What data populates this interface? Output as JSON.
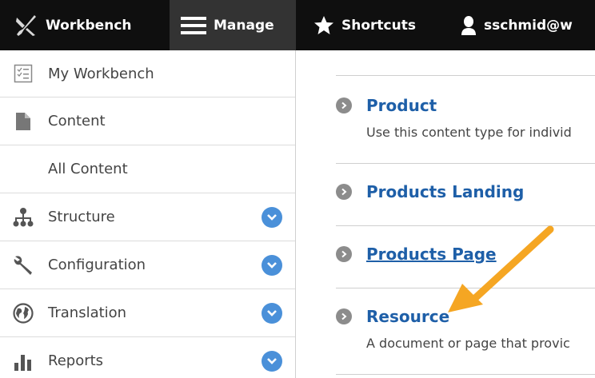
{
  "toolbar": {
    "workbench": "Workbench",
    "manage": "Manage",
    "shortcuts": "Shortcuts",
    "user": "sschmid@w"
  },
  "sidebar": {
    "items": [
      {
        "label": "My Workbench",
        "icon": "checklist-icon"
      },
      {
        "label": "Content",
        "icon": "document-icon"
      },
      {
        "label": "All Content"
      },
      {
        "label": "Structure",
        "icon": "sitemap-icon"
      },
      {
        "label": "Configuration",
        "icon": "wrench-icon"
      },
      {
        "label": "Translation",
        "icon": "globe-icon"
      },
      {
        "label": "Reports",
        "icon": "bar-chart-icon"
      }
    ]
  },
  "content_types": [
    {
      "name": "Product",
      "description": "Use this content type for individ"
    },
    {
      "name": "Products Landing",
      "description": ""
    },
    {
      "name": "Products Page",
      "description": ""
    },
    {
      "name": "Resource",
      "description": "A document or page that provic"
    }
  ],
  "colors": {
    "toolbar_bg": "#0f0f0f",
    "active_tab": "#333333",
    "link": "#1e5fa8",
    "toggle": "#4a90d9",
    "arrow": "#f5a623"
  }
}
